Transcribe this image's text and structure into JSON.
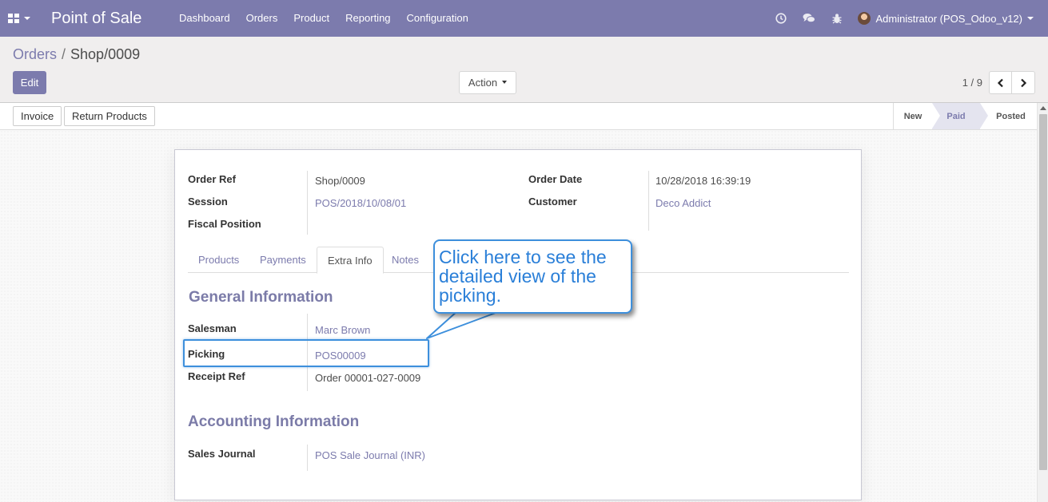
{
  "navbar": {
    "app_title": "Point of Sale",
    "menu": [
      "Dashboard",
      "Orders",
      "Product",
      "Reporting",
      "Configuration"
    ],
    "user_name": "Administrator (POS_Odoo_v12)",
    "icons": [
      "clock-icon",
      "chat-icon",
      "bug-icon"
    ]
  },
  "breadcrumb": {
    "parent": "Orders",
    "separator": "/",
    "current": "Shop/0009"
  },
  "control": {
    "edit_label": "Edit",
    "action_label": "Action",
    "pager_value": "1 / 9"
  },
  "statusbar": {
    "buttons": [
      "Invoice",
      "Return Products"
    ],
    "steps": [
      "New",
      "Paid",
      "Posted"
    ],
    "active_step": "Paid"
  },
  "form": {
    "order_ref_label": "Order Ref",
    "order_ref": "Shop/0009",
    "session_label": "Session",
    "session": "POS/2018/10/08/01",
    "fiscal_position_label": "Fiscal Position",
    "order_date_label": "Order Date",
    "order_date": "10/28/2018 16:39:19",
    "customer_label": "Customer",
    "customer": "Deco Addict",
    "tabs": [
      "Products",
      "Payments",
      "Extra Info",
      "Notes"
    ],
    "active_tab": "Extra Info",
    "general_title": "General Information",
    "salesman_label": "Salesman",
    "salesman": "Marc Brown",
    "picking_label": "Picking",
    "picking": "POS00009",
    "receipt_ref_label": "Receipt Ref",
    "receipt_ref": "Order 00001-027-0009",
    "accounting_title": "Accounting Information",
    "sales_journal_label": "Sales Journal",
    "sales_journal": "POS Sale Journal (INR)"
  },
  "callout": {
    "text": "Click here to see the detailed view of the picking."
  },
  "colors": {
    "brand": "#7c7bad",
    "callout": "#3d8fdc"
  }
}
